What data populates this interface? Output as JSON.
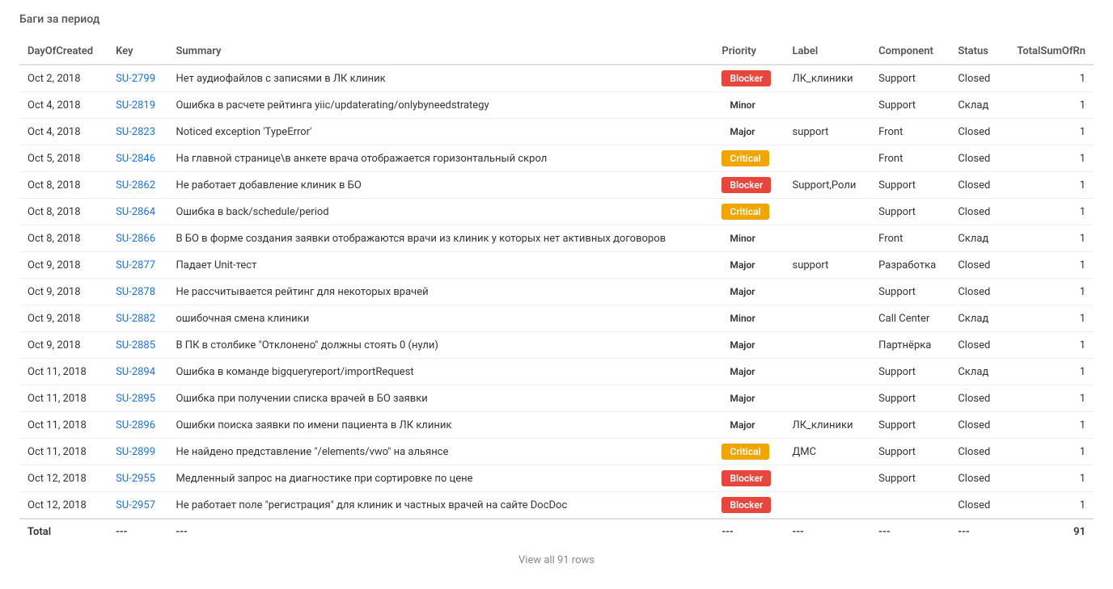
{
  "section": {
    "title": "Баги за период"
  },
  "table": {
    "columns": [
      {
        "id": "day",
        "label": "DayOfCreated"
      },
      {
        "id": "key",
        "label": "Key"
      },
      {
        "id": "summary",
        "label": "Summary"
      },
      {
        "id": "priority",
        "label": "Priority"
      },
      {
        "id": "label",
        "label": "Label"
      },
      {
        "id": "component",
        "label": "Component"
      },
      {
        "id": "status",
        "label": "Status"
      },
      {
        "id": "total",
        "label": "TotalSumOfRn",
        "align": "right"
      }
    ],
    "rows": [
      {
        "day": "Oct 2, 2018",
        "key": "SU-2799",
        "summary": "Нет аудиофайлов с записями в ЛК клиник",
        "priority": "Blocker",
        "priority_type": "blocker",
        "label": "ЛК_клиники",
        "component": "Support",
        "status": "Closed",
        "total": "1"
      },
      {
        "day": "Oct 4, 2018",
        "key": "SU-2819",
        "summary": "Ошибка в расчете рейтинга yiic/updaterating/onlybyneedstrategy",
        "priority": "Minor",
        "priority_type": "minor",
        "label": "",
        "component": "Support",
        "status": "Склад",
        "total": "1"
      },
      {
        "day": "Oct 4, 2018",
        "key": "SU-2823",
        "summary": "Noticed exception 'TypeError'",
        "priority": "Major",
        "priority_type": "major",
        "label": "support",
        "component": "Front",
        "status": "Closed",
        "total": "1"
      },
      {
        "day": "Oct 5, 2018",
        "key": "SU-2846",
        "summary": "На главной странице\\в анкете врача отображается горизонтальный скрол",
        "priority": "Critical",
        "priority_type": "critical",
        "label": "",
        "component": "Front",
        "status": "Closed",
        "total": "1"
      },
      {
        "day": "Oct 8, 2018",
        "key": "SU-2862",
        "summary": "Не работает добавление клиник в БО",
        "priority": "Blocker",
        "priority_type": "blocker",
        "label": "Support,Роли",
        "component": "Support",
        "status": "Closed",
        "total": "1"
      },
      {
        "day": "Oct 8, 2018",
        "key": "SU-2864",
        "summary": "Ошибка в back/schedule/period",
        "priority": "Critical",
        "priority_type": "critical",
        "label": "",
        "component": "Support",
        "status": "Closed",
        "total": "1"
      },
      {
        "day": "Oct 8, 2018",
        "key": "SU-2866",
        "summary": "В БО в форме создания заявки отображаются врачи из клиник у которых нет активных договоров",
        "priority": "Minor",
        "priority_type": "minor",
        "label": "",
        "component": "Front",
        "status": "Склад",
        "total": "1"
      },
      {
        "day": "Oct 9, 2018",
        "key": "SU-2877",
        "summary": "Падает Unit-тест",
        "priority": "Major",
        "priority_type": "major",
        "label": "support",
        "component": "Разработка",
        "status": "Closed",
        "total": "1"
      },
      {
        "day": "Oct 9, 2018",
        "key": "SU-2878",
        "summary": "Не рассчитывается рейтинг для некоторых врачей",
        "priority": "Major",
        "priority_type": "major",
        "label": "",
        "component": "Support",
        "status": "Closed",
        "total": "1"
      },
      {
        "day": "Oct 9, 2018",
        "key": "SU-2882",
        "summary": "ошибочная смена клиники",
        "priority": "Minor",
        "priority_type": "minor",
        "label": "",
        "component": "Call Center",
        "status": "Склад",
        "total": "1"
      },
      {
        "day": "Oct 9, 2018",
        "key": "SU-2885",
        "summary": "В ПК в столбике \"Отклонено\" должны стоять 0 (нули)",
        "priority": "Major",
        "priority_type": "major",
        "label": "",
        "component": "Партнёрка",
        "status": "Closed",
        "total": "1"
      },
      {
        "day": "Oct 11, 2018",
        "key": "SU-2894",
        "summary": "Ошибка в команде bigqueryreport/importRequest",
        "priority": "Major",
        "priority_type": "major",
        "label": "",
        "component": "Support",
        "status": "Склад",
        "total": "1"
      },
      {
        "day": "Oct 11, 2018",
        "key": "SU-2895",
        "summary": "Ошибка при получении списка врачей в БО заявки",
        "priority": "Major",
        "priority_type": "major",
        "label": "",
        "component": "Support",
        "status": "Closed",
        "total": "1"
      },
      {
        "day": "Oct 11, 2018",
        "key": "SU-2896",
        "summary": "Ошибки поиска заявки по имени пациента в ЛК клиник",
        "priority": "Major",
        "priority_type": "major",
        "label": "ЛК_клиники",
        "component": "Support",
        "status": "Closed",
        "total": "1"
      },
      {
        "day": "Oct 11, 2018",
        "key": "SU-2899",
        "summary": "Не найдено представление \"/elements/vwo\" на альянсе",
        "priority": "Critical",
        "priority_type": "critical",
        "label": "ДМС",
        "component": "Support",
        "status": "Closed",
        "total": "1"
      },
      {
        "day": "Oct 12, 2018",
        "key": "SU-2955",
        "summary": "Медленный запрос на диагностике при сортировке по цене",
        "priority": "Blocker",
        "priority_type": "blocker",
        "label": "",
        "component": "Support",
        "status": "Closed",
        "total": "1"
      },
      {
        "day": "Oct 12, 2018",
        "key": "SU-2957",
        "summary": "Не работает поле \"регистрация\" для клиник и частных врачей на сайте DocDoc",
        "priority": "Blocker",
        "priority_type": "blocker",
        "label": "",
        "component": "",
        "status": "Closed",
        "total": "1"
      }
    ],
    "footer": {
      "day": "Total",
      "key": "---",
      "summary": "---",
      "priority": "---",
      "label": "---",
      "component": "---",
      "status": "---",
      "total": "91"
    },
    "view_all": "View all 91 rows"
  }
}
